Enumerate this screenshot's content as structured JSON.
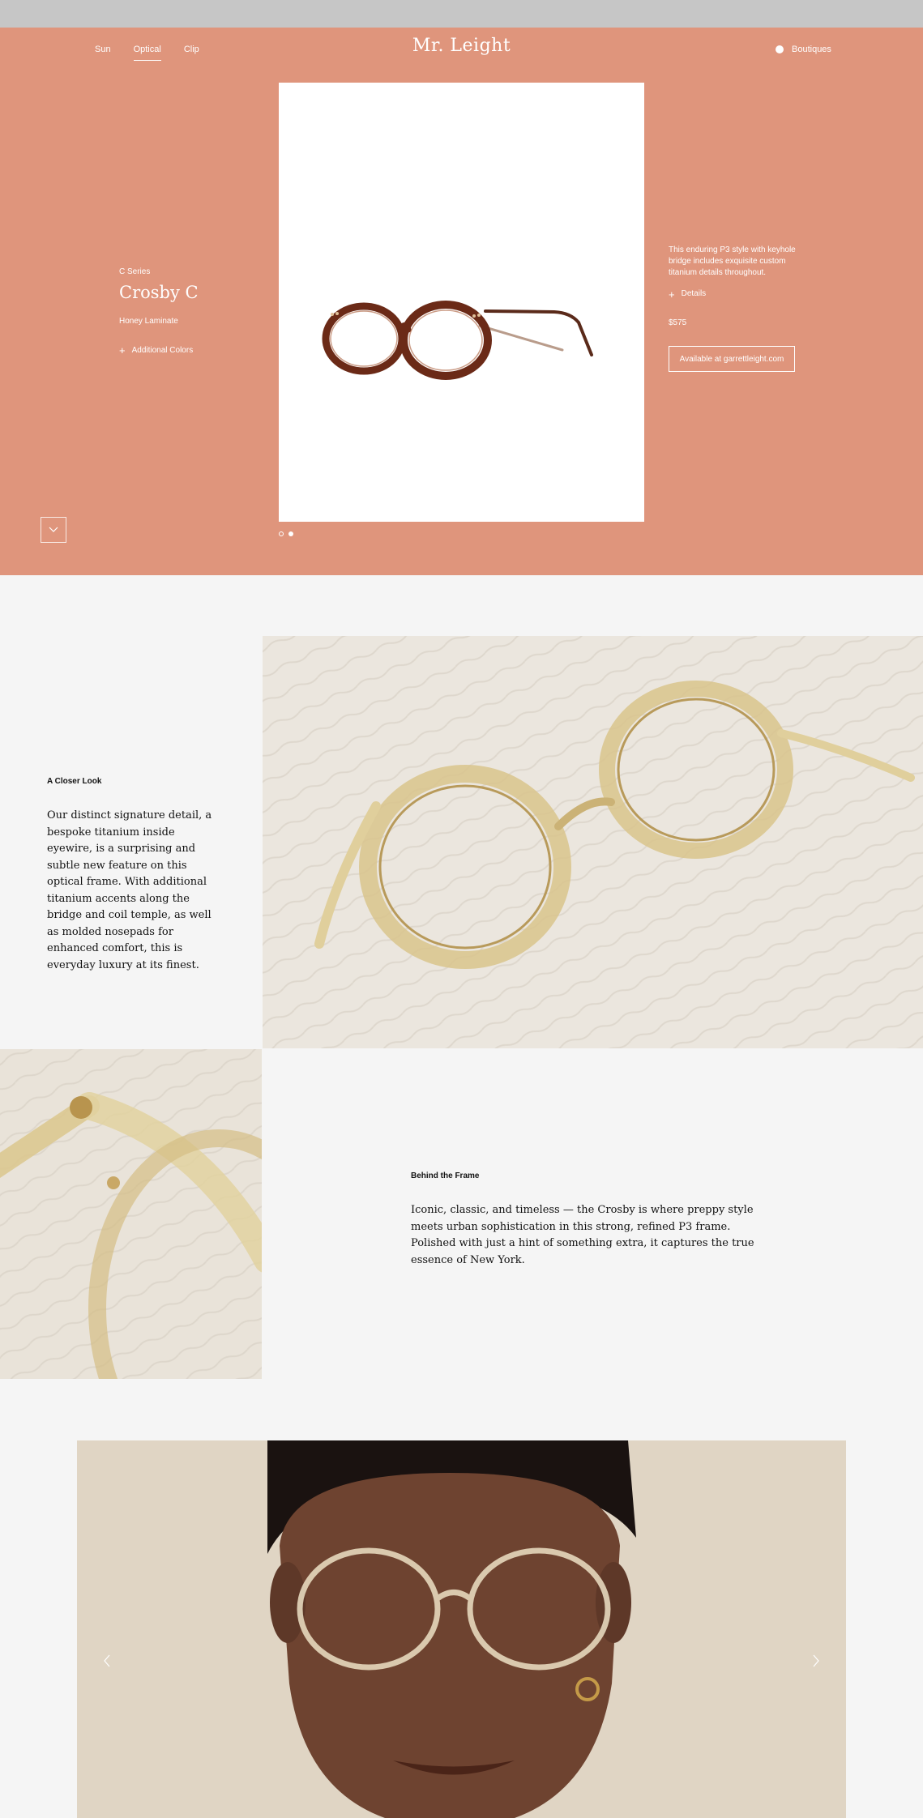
{
  "nav": {
    "items": [
      {
        "label": "Sun",
        "active": false
      },
      {
        "label": "Optical",
        "active": true
      },
      {
        "label": "Clip",
        "active": false
      }
    ],
    "logo": "Mr. Leight",
    "boutiques_label": "Boutiques"
  },
  "product": {
    "series": "C Series",
    "name": "Crosby C",
    "variant": "Honey Laminate",
    "additional_colors": "Additional Colors",
    "description": "This enduring P3 style with keyhole bridge includes exquisite custom titanium details throughout.",
    "details_label": "Details",
    "price": "$575",
    "cta": "Available at garrettleight.com",
    "frame_color": "#6b2a17"
  },
  "pager": {
    "count": 2,
    "active_index": 1
  },
  "closer_look": {
    "title": "A Closer Look",
    "body": "Our distinct signature detail, a bespoke titanium inside eyewire, is a surprising and subtle new feature on this optical frame. With additional titanium accents along the bridge and coil temple, as well as molded nosepads for enhanced comfort, this is everyday luxury at its finest."
  },
  "behind_frame": {
    "title": "Behind the Frame",
    "body": "Iconic, classic, and timeless — the Crosby is where preppy style meets urban sophistication in this strong, refined P3 frame. Polished with just a hint of something extra, it captures the true essence of New York."
  },
  "colors": {
    "hero_bg": "#df957c",
    "page_bg": "#f5f5f5",
    "honey_frame": "#d9c48c"
  }
}
